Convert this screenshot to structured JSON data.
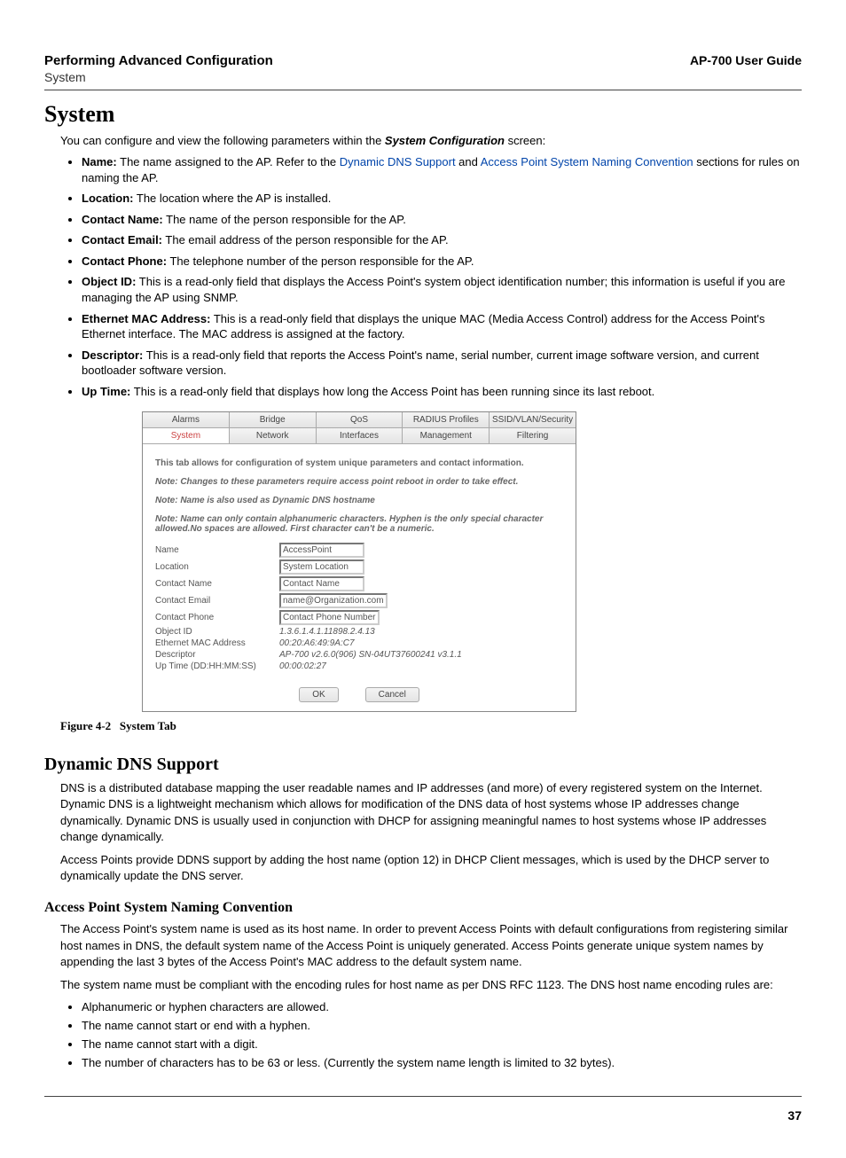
{
  "header": {
    "left": "Performing Advanced Configuration",
    "right": "AP-700 User Guide",
    "sub": "System"
  },
  "h1": "System",
  "intro_prefix": "You can configure and view the following parameters within the ",
  "intro_bold": "System Configuration",
  "intro_suffix": " screen:",
  "params": [
    {
      "label": "Name:",
      "text_before": " The name assigned to the AP. Refer to the ",
      "link1": "Dynamic DNS Support",
      "mid": " and ",
      "link2": "Access Point System Naming Convention",
      "text_after": " sections for rules on naming the AP."
    },
    {
      "label": "Location:",
      "text": " The location where the AP is installed."
    },
    {
      "label": "Contact Name:",
      "text": " The name of the person responsible for the AP."
    },
    {
      "label": "Contact Email:",
      "text": " The email address of the person responsible for the AP."
    },
    {
      "label": "Contact Phone:",
      "text": " The telephone number of the person responsible for the AP."
    },
    {
      "label": "Object ID:",
      "text": " This is a read-only field that displays the Access Point's system object identification number; this information is useful if you are managing the AP using SNMP."
    },
    {
      "label": "Ethernet MAC Address:",
      "text": " This is a read-only field that displays the unique MAC (Media Access Control) address for the Access Point's Ethernet interface. The MAC address is assigned at the factory."
    },
    {
      "label": "Descriptor:",
      "text": " This is a read-only field that reports the Access Point's name, serial number, current image software version, and current bootloader software version."
    },
    {
      "label": "Up Time:",
      "text": " This is a read-only field that displays how long the Access Point has been running since its last reboot."
    }
  ],
  "panel": {
    "tabs_row1": [
      "Alarms",
      "Bridge",
      "QoS",
      "RADIUS Profiles",
      "SSID/VLAN/Security"
    ],
    "tabs_row2": [
      "System",
      "Network",
      "Interfaces",
      "Management",
      "Filtering"
    ],
    "selected_tab": "System",
    "body_text": "This tab allows for configuration of system unique parameters and contact information.",
    "note1": "Note: Changes to these parameters require access point reboot in order to take effect.",
    "note2": "Note: Name is also used as Dynamic DNS hostname",
    "note3": "Note: Name can only contain alphanumeric characters. Hyphen is the only special character allowed.No spaces are allowed. First character can't be a numeric.",
    "fields": {
      "name_label": "Name",
      "name_value": "AccessPoint",
      "location_label": "Location",
      "location_value": "System Location",
      "contact_name_label": "Contact Name",
      "contact_name_value": "Contact Name",
      "contact_email_label": "Contact Email",
      "contact_email_value": "name@Organization.com",
      "contact_phone_label": "Contact Phone",
      "contact_phone_value": "Contact Phone Number",
      "object_id_label": "Object ID",
      "object_id_value": "1.3.6.1.4.1.11898.2.4.13",
      "mac_label": "Ethernet MAC Address",
      "mac_value": "00:20:A6:49:9A:C7",
      "descriptor_label": "Descriptor",
      "descriptor_value": "AP-700 v2.6.0(906) SN-04UT37600241 v3.1.1",
      "uptime_label": "Up Time (DD:HH:MM:SS)",
      "uptime_value": "00:00:02:27"
    },
    "ok": "OK",
    "cancel": "Cancel"
  },
  "figure_caption_label": "Figure 4-2",
  "figure_caption_text": "System Tab",
  "ddns_heading": "Dynamic DNS Support",
  "ddns_p1": "DNS is a distributed database mapping the user readable names and IP addresses (and more) of every registered system on the Internet. Dynamic DNS is a lightweight mechanism which allows for modification of the DNS data of host systems whose IP addresses change dynamically. Dynamic DNS is usually used in conjunction with DHCP for assigning meaningful names to host systems whose IP addresses change dynamically.",
  "ddns_p2": "Access Points provide DDNS support by adding the host name (option 12) in DHCP Client messages, which is used by the DHCP server to dynamically update the DNS server.",
  "naming_heading": "Access Point System Naming Convention",
  "naming_p1": "The Access Point's system name is used as its host name. In order to prevent Access Points with default configurations from registering similar host names in DNS, the default system name of the Access Point is uniquely generated. Access Points generate unique system names by appending the last 3 bytes of the Access Point's MAC address to the default system name.",
  "naming_p2": "The system name must be compliant with the encoding rules for host name as per DNS RFC 1123. The DNS host name encoding rules are:",
  "rules": [
    "Alphanumeric or hyphen characters are allowed.",
    "The name cannot start or end with a hyphen.",
    "The name cannot start with a digit.",
    "The number of characters has to be 63 or less. (Currently the system name length is limited to 32 bytes)."
  ],
  "page_number": "37"
}
